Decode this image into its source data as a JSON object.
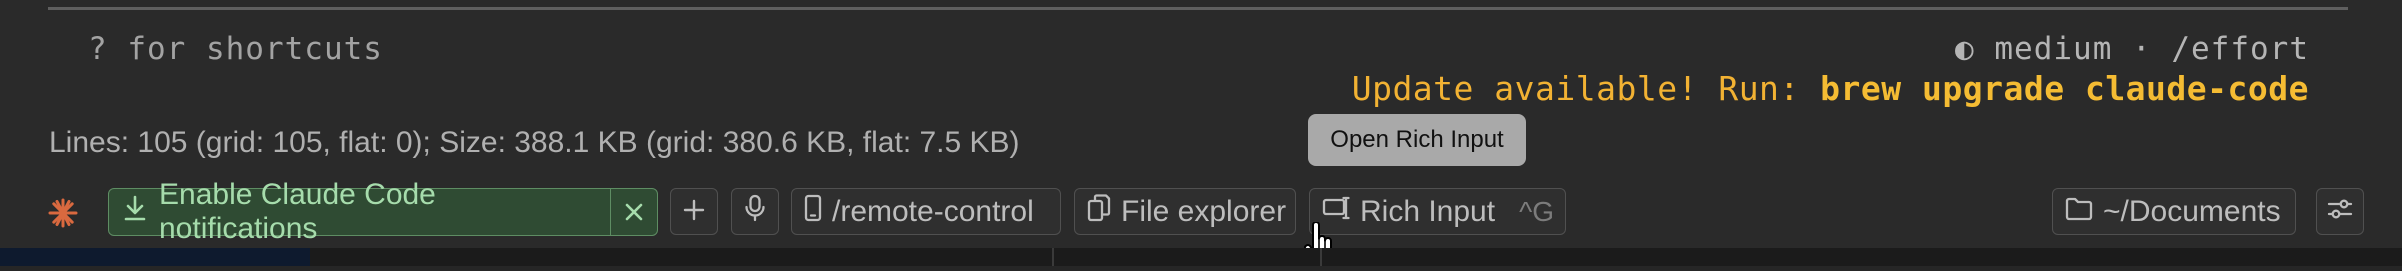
{
  "terminal": {
    "hint": "? for shortcuts",
    "effort": "◐ medium · /effort",
    "update_prefix": "Update available! Run: ",
    "update_command": "brew upgrade claude-code",
    "stats": "Lines: 105 (grid: 105, flat: 0); Size: 388.1 KB (grid: 380.6 KB, flat: 7.5 KB)"
  },
  "tooltip": {
    "text": "Open Rich Input"
  },
  "toolbar": {
    "notification_label": "Enable Claude Code notifications",
    "remote_label": "/remote-control",
    "explorer_label": "File explorer",
    "rich_input_label": "Rich Input",
    "rich_input_shortcut": "^G",
    "folder_label": "~/Documents"
  },
  "icons": {
    "logo": "claude-burst-icon",
    "notification": "download-icon",
    "close": "close-icon",
    "add": "plus-icon",
    "mic": "microphone-icon",
    "remote": "phone-icon",
    "explorer": "files-icon",
    "rich_input": "rich-input-icon",
    "folder": "folder-icon",
    "settings": "sliders-icon",
    "cursor": "hand-pointer-icon"
  },
  "colors": {
    "background": "#2a2a2a",
    "accent_orange": "#d9693f",
    "update_yellow": "#f2b233",
    "notification_green": "#a6dcac"
  }
}
